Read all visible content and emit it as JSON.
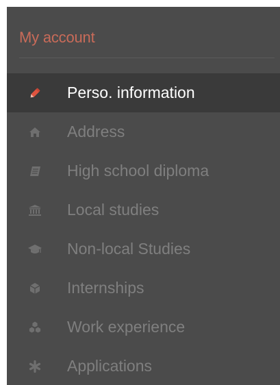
{
  "sidebar": {
    "title": "My account",
    "active_index": 0,
    "accent_color": "#c96b59",
    "items": [
      {
        "label": "Perso. information",
        "icon": "pencil-icon",
        "active": true
      },
      {
        "label": "Address",
        "icon": "home-icon",
        "active": false
      },
      {
        "label": "High school diploma",
        "icon": "book-icon",
        "active": false
      },
      {
        "label": "Local studies",
        "icon": "institution-icon",
        "active": false
      },
      {
        "label": "Non-local Studies",
        "icon": "graduation-cap-icon",
        "active": false
      },
      {
        "label": "Internships",
        "icon": "cube-icon",
        "active": false
      },
      {
        "label": "Work experience",
        "icon": "cubes-icon",
        "active": false
      },
      {
        "label": "Applications",
        "icon": "asterisk-icon",
        "active": false
      }
    ]
  }
}
